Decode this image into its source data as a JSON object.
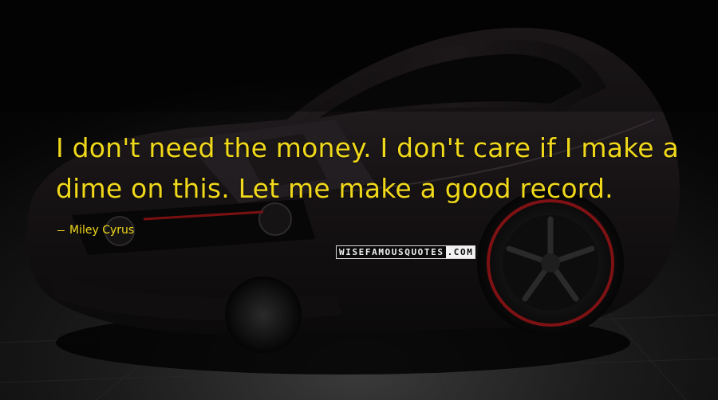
{
  "image": {
    "background_subject": "dark-muscle-car-icon",
    "accent_color": "#f0d81a",
    "background_color": "#050505"
  },
  "quote": {
    "text": "I don't need the money. I don't care if I make a dime on this. Let me make a good record.",
    "author": "Miley Cyrus"
  },
  "watermark": {
    "main": "WISEFAMOUSQUOTES",
    "tld": ".COM"
  }
}
